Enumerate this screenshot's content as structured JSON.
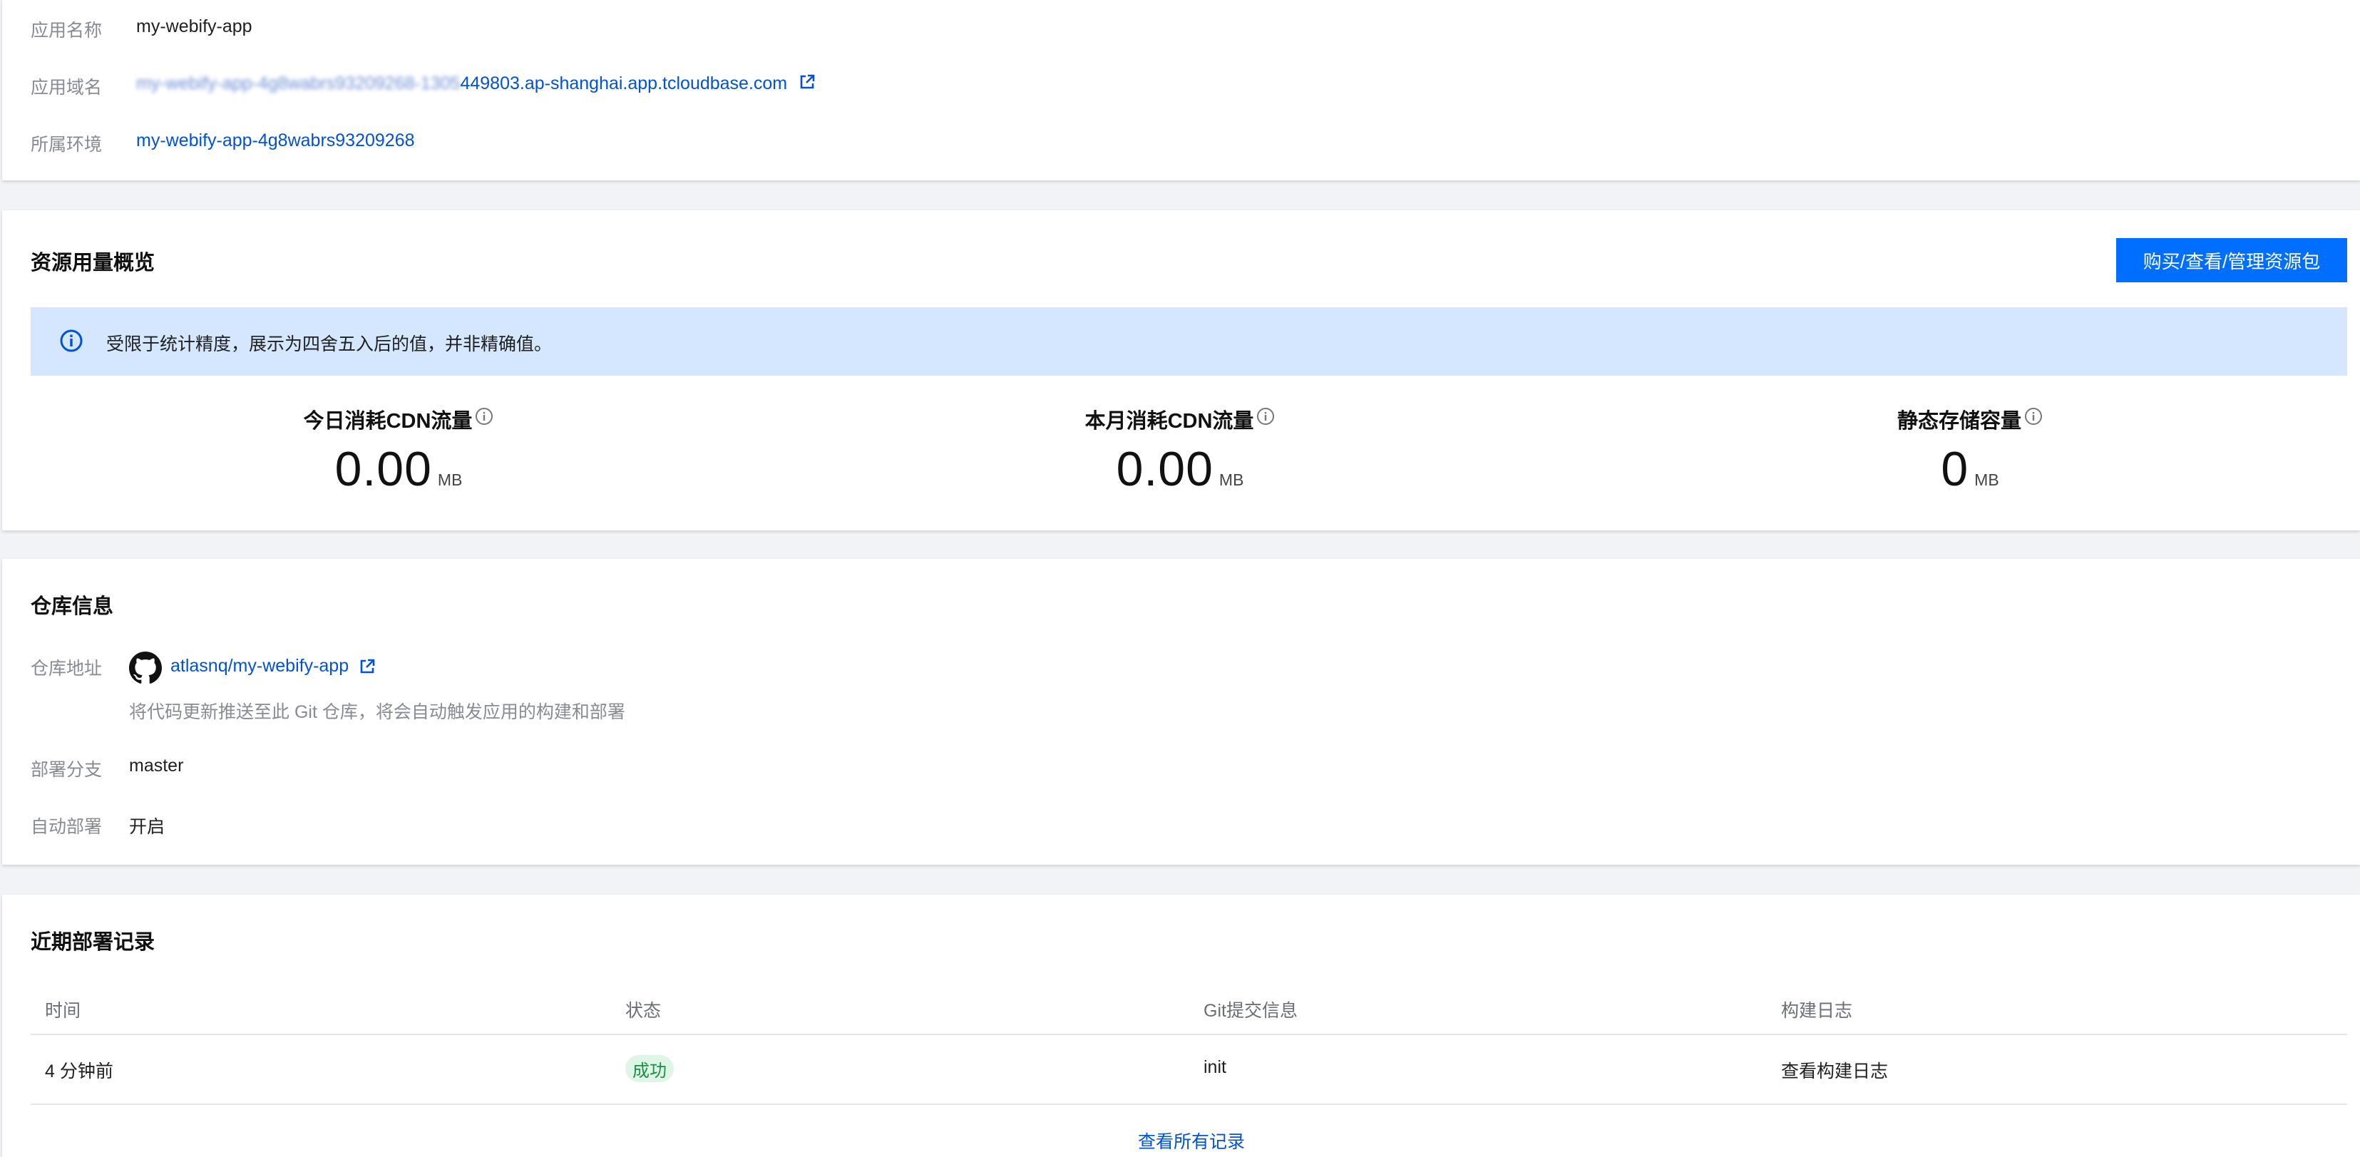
{
  "app_info": {
    "name_label": "应用名称",
    "name_value": "my-webify-app",
    "domain_label": "应用域名",
    "domain_prefix_blurred": "my-webify-app-4g8wabrs93209268-1305",
    "domain_suffix": "449803.ap-shanghai.app.tcloudbase.com",
    "env_label": "所属环境",
    "env_value": "my-webify-app-4g8wabrs93209268"
  },
  "resource": {
    "title": "资源用量概览",
    "manage_button": "购买/查看/管理资源包",
    "notice": "受限于统计精度，展示为四舍五入后的值，并非精确值。",
    "stats": [
      {
        "title": "今日消耗CDN流量",
        "value": "0.00",
        "unit": "MB"
      },
      {
        "title": "本月消耗CDN流量",
        "value": "0.00",
        "unit": "MB"
      },
      {
        "title": "静态存储容量",
        "value": "0",
        "unit": "MB"
      }
    ]
  },
  "repo": {
    "title": "仓库信息",
    "address_label": "仓库地址",
    "repo_name": "atlasnq/my-webify-app",
    "repo_hint": "将代码更新推送至此 Git 仓库，将会自动触发应用的构建和部署",
    "branch_label": "部署分支",
    "branch_value": "master",
    "auto_deploy_label": "自动部署",
    "auto_deploy_value": "开启"
  },
  "deploy": {
    "title": "近期部署记录",
    "columns": [
      "时间",
      "状态",
      "Git提交信息",
      "构建日志"
    ],
    "rows": [
      {
        "time": "4 分钟前",
        "status": "成功",
        "commit": "init",
        "log_link": "查看构建日志"
      }
    ],
    "view_all": "查看所有记录"
  },
  "colors": {
    "primary": "#006eff",
    "link": "#0052d9",
    "notice_bg": "#d5e7ff",
    "success_bg": "#dff5e6",
    "success_text": "#1a9149"
  }
}
